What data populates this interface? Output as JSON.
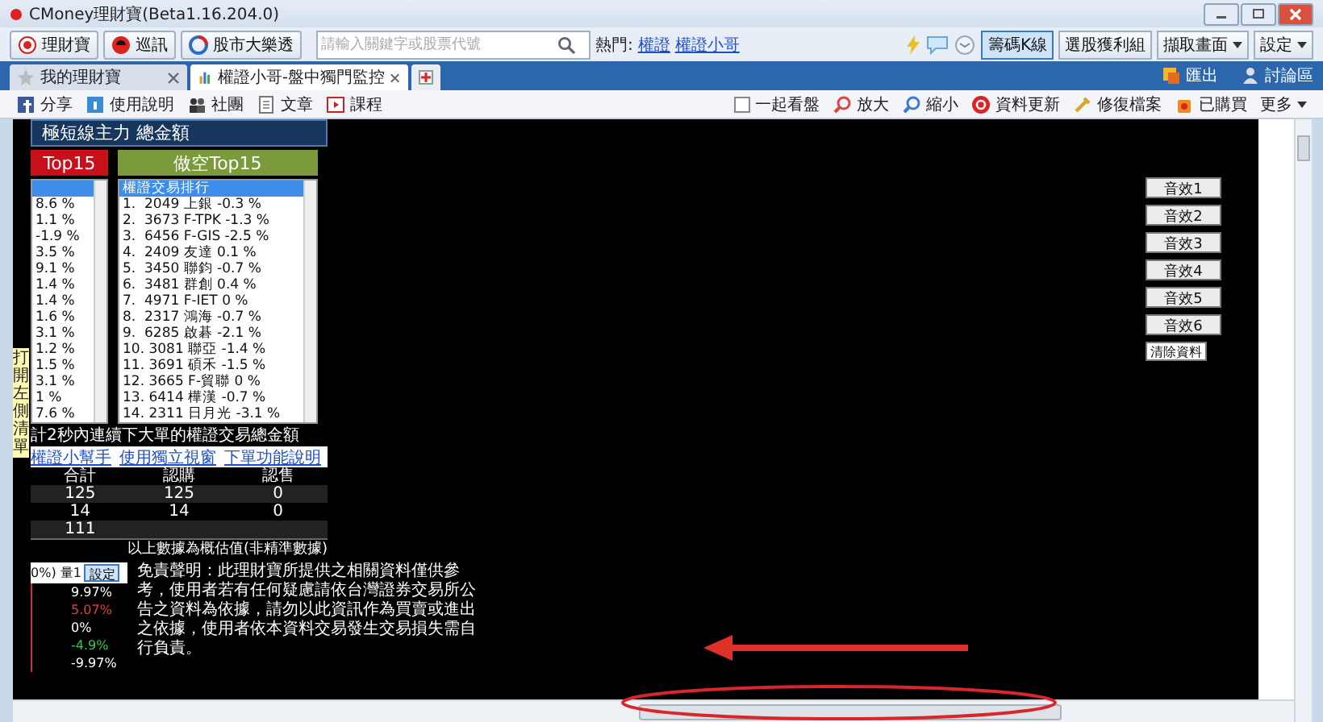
{
  "window": {
    "title": "CMoney理財寶(Beta1.16.204.0)"
  },
  "toolbar": {
    "apps": [
      {
        "label": "理財寶",
        "kind": "wealth"
      },
      {
        "label": "巡訊",
        "kind": "news"
      },
      {
        "label": "股市大樂透",
        "kind": "lottery"
      }
    ],
    "search": {
      "placeholder": "請輸入關鍵字或股票代號"
    },
    "hot_label": "熱門:",
    "hot_links": [
      "權證",
      "權證小哥"
    ],
    "right_buttons": [
      {
        "label": "籌碼K線",
        "selected": true,
        "dropdown": false
      },
      {
        "label": "選股獲利組",
        "selected": false,
        "dropdown": false
      },
      {
        "label": "擷取畫面",
        "selected": false,
        "dropdown": true
      },
      {
        "label": "設定",
        "selected": false,
        "dropdown": true
      }
    ]
  },
  "tabs": [
    {
      "label": "我的理財寶",
      "selected": false
    },
    {
      "label": "權證小哥-盤中獨門監控",
      "selected": true
    }
  ],
  "tab_actions": [
    {
      "label": "匯出",
      "kind": "export"
    },
    {
      "label": "討論區",
      "kind": "discuss"
    }
  ],
  "subtoolbar": {
    "left": [
      {
        "label": "分享",
        "kind": "share"
      },
      {
        "label": "使用說明",
        "kind": "help"
      },
      {
        "label": "社團",
        "kind": "community"
      },
      {
        "label": "文章",
        "kind": "article"
      },
      {
        "label": "課程",
        "kind": "course"
      }
    ],
    "watch_together": {
      "label": "一起看盤",
      "checked": false
    },
    "right": [
      {
        "label": "放大",
        "kind": "zoom-in"
      },
      {
        "label": "縮小",
        "kind": "zoom-out"
      },
      {
        "label": "資料更新",
        "kind": "refresh"
      },
      {
        "label": "修復檔案",
        "kind": "repair"
      },
      {
        "label": "已購買",
        "kind": "purchased"
      }
    ],
    "more": "更多"
  },
  "panel": {
    "title": "極短線主力 總金額",
    "side_tag": "打開左側清單",
    "long_list": {
      "title": "Top15",
      "items": [
        "8.6 %",
        "1.1 %",
        "-1.9 %",
        "3.5 %",
        "9.1 %",
        "1.4 %",
        "1.4 %",
        "1.6 %",
        "3.1 %",
        "1.2 %",
        "1.5 %",
        "3.1 %",
        "1 %",
        "7.6 %"
      ]
    },
    "short_list": {
      "title": "做空Top15",
      "header": "權證交易排行",
      "items": [
        "1.  2049 上銀 -0.3 %",
        "2.  3673 F-TPK -1.3 %",
        "3.  6456 F-GIS -2.5 %",
        "4.  2409 友達 0.1 %",
        "5.  3450 聯鈞 -0.7 %",
        "6.  3481 群創 0.4 %",
        "7.  4971 F-IET 0 %",
        "8.  2317 鴻海 -0.7 %",
        "9.  6285 啟碁 -2.1 %",
        "10. 3081 聯亞 -1.4 %",
        "11. 3691 碩禾 -1.5 %",
        "12. 3665 F-貿聯 0 %",
        "13. 6414 樺漢 -0.7 %",
        "14. 2311 日月光 -3.1 %"
      ]
    },
    "caption": "計2秒內連續下大單的權證交易總金額",
    "links": [
      "權證小幫手",
      "使用獨立視窗",
      "下單功能說明"
    ],
    "table": {
      "columns": [
        "合計",
        "認購",
        "認售"
      ],
      "rows": [
        [
          "125",
          "125",
          "0"
        ],
        [
          "14",
          "14",
          "0"
        ],
        [
          "111"
        ]
      ]
    },
    "footnote": "以上數據為概估值(非精準數據)",
    "chart_header": "0%) 量1",
    "chart_button": "設定",
    "scale": [
      {
        "label": "9.97%",
        "color": "#ffffff"
      },
      {
        "label": "5.07%",
        "color": "#e03c3c"
      },
      {
        "label": "0%",
        "color": "#ffffff"
      },
      {
        "label": "-4.9%",
        "color": "#3cc83c"
      },
      {
        "label": "-9.97%",
        "color": "#ffffff"
      }
    ],
    "disclaimer": "免責聲明：此理財寶所提供之相關資料僅供參考，使用者若有任何疑慮請依台灣證券交易所公告之資料為依據，請勿以此資訊作為買賣或進出之依據，使用者依本資料交易發生交易損失需自行負責。"
  },
  "sound_buttons": [
    "音效1",
    "音效2",
    "音效3",
    "音效4",
    "音效5",
    "音效6"
  ],
  "clear_button": "清除資料"
}
